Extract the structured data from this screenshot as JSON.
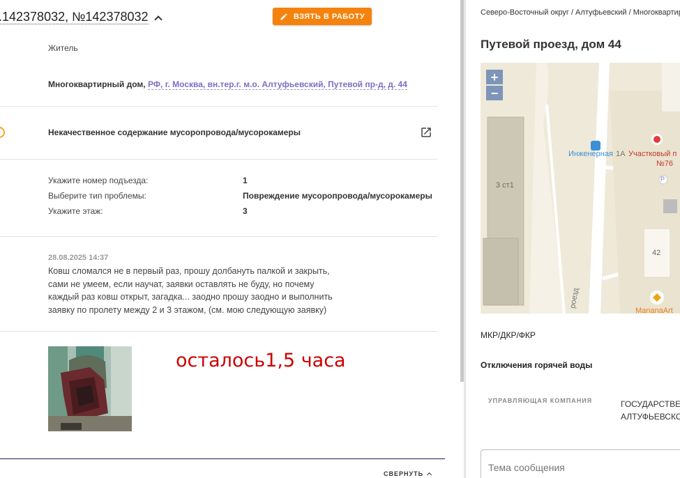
{
  "ticket": {
    "title": ".142378032, №142378032",
    "take_button_label": "ВЗЯТЬ В РАБОТУ",
    "applicant_type": "Житель",
    "address_prefix": "Многоквартирный дом,",
    "address_link": "РФ, г. Москва, вн.тер.г. м.о. Алтуфьевский, Путевой пр-д, д. 44",
    "category": "Некачественное содержание мусоропровода/мусорокамеры",
    "details": [
      {
        "label": "Укажите номер подъезда:",
        "value": "1"
      },
      {
        "label": "Выберите тип проблемы:",
        "value": "Повреждение мусоропровода/мусорокамеры"
      },
      {
        "label": "Укажите этаж:",
        "value": "3"
      }
    ],
    "comment": {
      "date": "28.08.2025 14:37",
      "lines": [
        "Ковш сломался не в первый раз, прошу долбануть палкой и закрыть,",
        "сами не умеем, если научат, заявки оставлять не буду, но почему",
        "каждый раз ковш открыт, загадка... заодно прошу заодно и выполнить",
        "заявку по пролету между 2 и 3 этажом, (см. мою следующую заявку)"
      ]
    },
    "overlay_text": "осталось1,5 часа",
    "collapse_label": "СВЕРНУТЬ"
  },
  "side": {
    "breadcrumbs": "Северо-Восточный округ / Алтуфьевский / Многоквартирный",
    "house_title": "Путевой проезд, дом 44",
    "map": {
      "zoom_in": "+",
      "zoom_out": "−",
      "building_label": "3 ст1",
      "stop_label": "Инженерная",
      "stop_num": "1А",
      "poi_label": "Участковый п",
      "poi_num": "№76",
      "house_num": "42",
      "parking": "P",
      "shop_label": "MananaArt",
      "road_label": "роезд"
    },
    "mkr": "МКР/ДКР/ФКР",
    "hot_water": "Отключения горячей воды",
    "uk_label": "УПРАВЛЯЮЩАЯ КОМПАНИЯ",
    "uk_value_1": "ГОСУДАРСТВЕННОЕ БЮДЖЕТНОЕ",
    "uk_value_2": "АЛТУФЬЕВСКОГО РАЙОНА",
    "message_placeholder": "Тема сообщения"
  },
  "colors": {
    "accent_orange": "#f5820d",
    "link": "#7a6fc5",
    "overlay_red": "#cc0000"
  }
}
